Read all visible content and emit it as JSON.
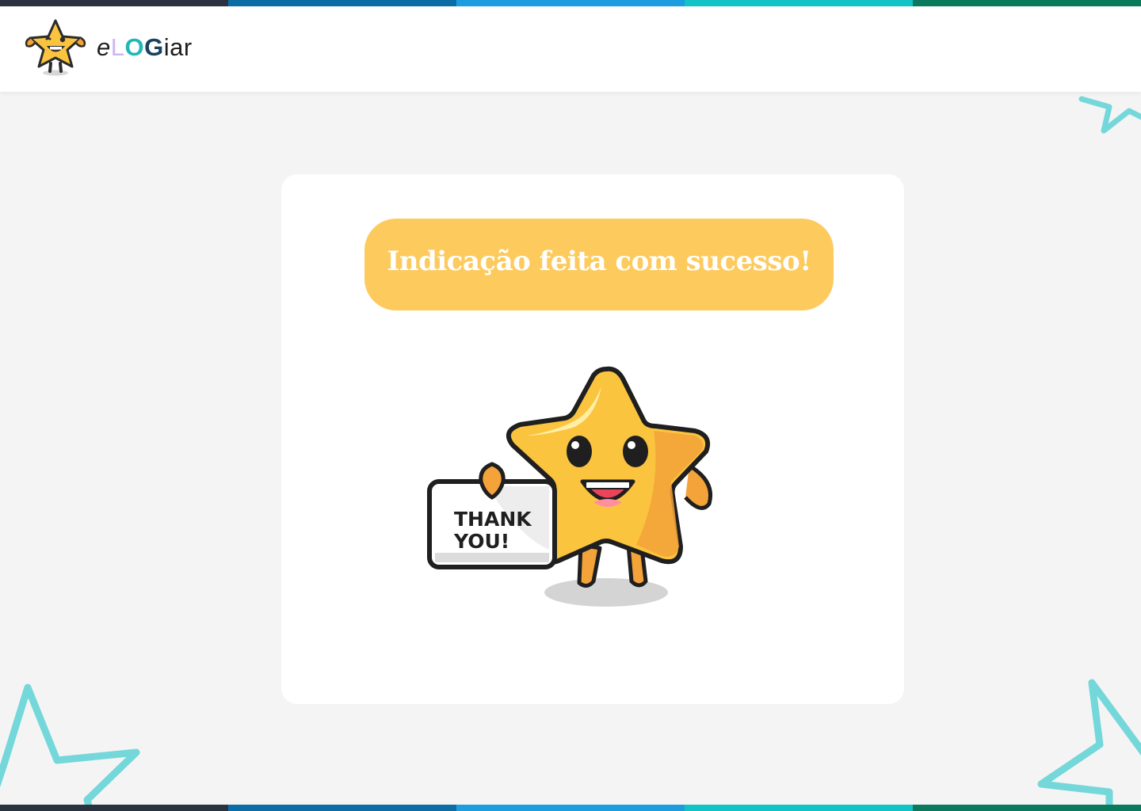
{
  "app": {
    "brand_parts": [
      "e",
      "L",
      "O",
      "G",
      "iar"
    ]
  },
  "stripe_colors": [
    "#2a3240",
    "#0c6da6",
    "#1d9de0",
    "#12c2c4",
    "#0b7a5c"
  ],
  "main": {
    "success_message": "Indicação feita com sucesso!",
    "sign_text_line1": "THANK",
    "sign_text_line2": "YOU!"
  },
  "colors": {
    "banner": "#fdca5d",
    "star_outline_decoration": "#74d7d9",
    "background": "#f4f4f4"
  }
}
